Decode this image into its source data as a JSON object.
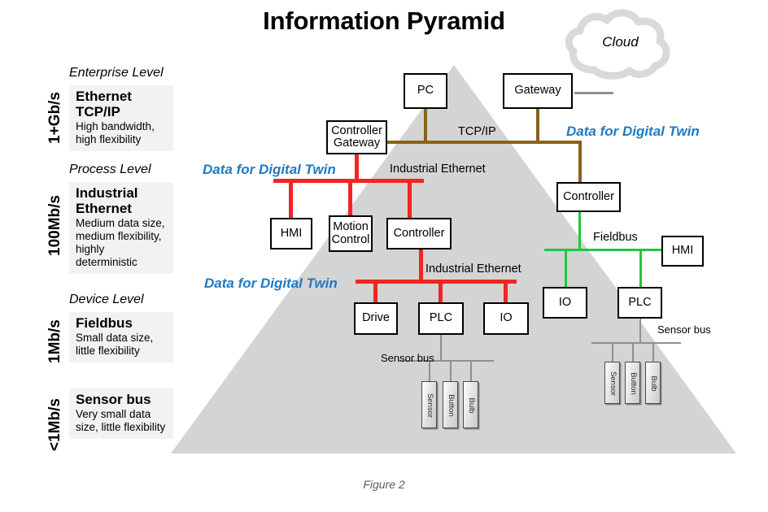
{
  "page": {
    "title": "Information Pyramid",
    "figure_caption": "Figure 2"
  },
  "colors": {
    "tcpip_bus": "#8a6218",
    "industrial_ethernet_bus": "#f22424",
    "fieldbus": "#22c63c",
    "sensor_bus": "#8f8f8f",
    "digital_twin_label": "#1f7ac4",
    "pyramid_fill": "#d4d4d4"
  },
  "levels": [
    {
      "rate": "1+Gb/s",
      "level_name": "Enterprise Level",
      "tech": "Ethernet TCP/IP",
      "desc": "High bandwidth, high flexibility"
    },
    {
      "rate": "100Mb/s",
      "level_name": "Process Level",
      "tech": "Industrial Ethernet",
      "desc": "Medium data size, medium flexibility, highly deterministic"
    },
    {
      "rate": "1Mb/s",
      "level_name": "Device Level",
      "tech": "Fieldbus",
      "desc": "Small data size, little flexibility"
    },
    {
      "rate": "<1Mb/s",
      "level_name": "",
      "tech": "Sensor bus",
      "desc": "Very small data size, little flexibility"
    }
  ],
  "cloud": {
    "label": "Cloud"
  },
  "nodes": {
    "pc": "PC",
    "gateway": "Gateway",
    "controller_gateway": "Controller Gateway",
    "hmi_left": "HMI",
    "motion_control": "Motion Control",
    "controller_mid": "Controller",
    "drive": "Drive",
    "plc_mid": "PLC",
    "io_mid": "IO",
    "controller_right": "Controller",
    "hmi_right": "HMI",
    "io_right": "IO",
    "plc_right": "PLC"
  },
  "bus_labels": {
    "tcpip": "TCP/IP",
    "industrial_ethernet_upper": "Industrial Ethernet",
    "industrial_ethernet_lower": "Industrial Ethernet",
    "fieldbus": "Fieldbus",
    "sensor_bus_mid": "Sensor bus",
    "sensor_bus_right": "Sensor bus"
  },
  "digital_twin_labels": {
    "top_right": "Data for Digital Twin",
    "middle_left": "Data for Digital Twin",
    "bottom_left": "Data for Digital Twin"
  },
  "sensor_devices_mid": [
    "Sensor",
    "Button",
    "Bulb"
  ],
  "sensor_devices_right": [
    "Sensor",
    "Button",
    "Bulb"
  ]
}
